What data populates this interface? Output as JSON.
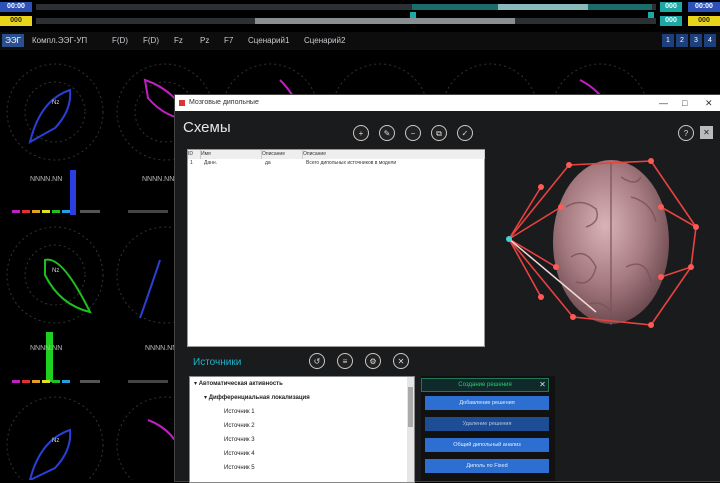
{
  "topbar": {
    "left_tag_1": "00:00",
    "left_tag_2": "000",
    "right_tag_1": "00:00",
    "right_tag_2": "000",
    "mid_tag_1": "000",
    "mid_tag_2": "000"
  },
  "toolbar": {
    "mode_button": "ЭЭГ",
    "tabs": [
      "Компл.ЭЭГ-УП",
      "F(D)",
      "F(D)",
      "Fz",
      "Pz",
      "F7",
      "Сценарий1",
      "Сценарий2"
    ],
    "window_controls": [
      "1",
      "2",
      "3",
      "4"
    ]
  },
  "background": {
    "value_labels": [
      "NNNN.NN",
      "NNNN.NN",
      "NNNN.NN",
      "NNNN.NN"
    ],
    "center_markers": [
      "Nz",
      "Nz",
      "Nz"
    ]
  },
  "dialog": {
    "window_title": "Мозговые дипольные",
    "title_controls": [
      "—",
      "□",
      "✕"
    ],
    "heading": "Схемы",
    "toolbar_icons": [
      "add-icon",
      "edit-icon",
      "minus-icon",
      "copy-icon",
      "check-icon"
    ],
    "right_icons": [
      "help-icon",
      "close-icon"
    ],
    "table": {
      "columns": [
        "ID",
        "Имя",
        "Описание",
        "Описание"
      ],
      "rows": [
        [
          "1",
          "Данн.",
          "да",
          "Всего дипольных источников в модели"
        ]
      ]
    },
    "sources_heading": "Источники",
    "sources_icons": [
      "back-icon",
      "list-icon",
      "settings-icon",
      "clear-icon"
    ],
    "tree": [
      {
        "label": "Автоматическая активность",
        "level": 0
      },
      {
        "label": "Дифференциальная локализация",
        "level": 1
      },
      {
        "label": "Источник 1",
        "level": 2
      },
      {
        "label": "Источник 2",
        "level": 2
      },
      {
        "label": "Источник 3",
        "level": 2
      },
      {
        "label": "Источник 4",
        "level": 2
      },
      {
        "label": "Источник 5",
        "level": 2
      }
    ],
    "panel": {
      "heading": "Создание решения",
      "buttons": [
        "Добавление решения",
        "Удаление решения",
        "Общий дипольный анализ",
        "Диполь по Fixed"
      ]
    }
  },
  "colors": {
    "accent_blue": "#2a4f8f",
    "teal": "#1aa9a4",
    "yellow": "#f5e214",
    "electrode_red": "#e8423f"
  }
}
